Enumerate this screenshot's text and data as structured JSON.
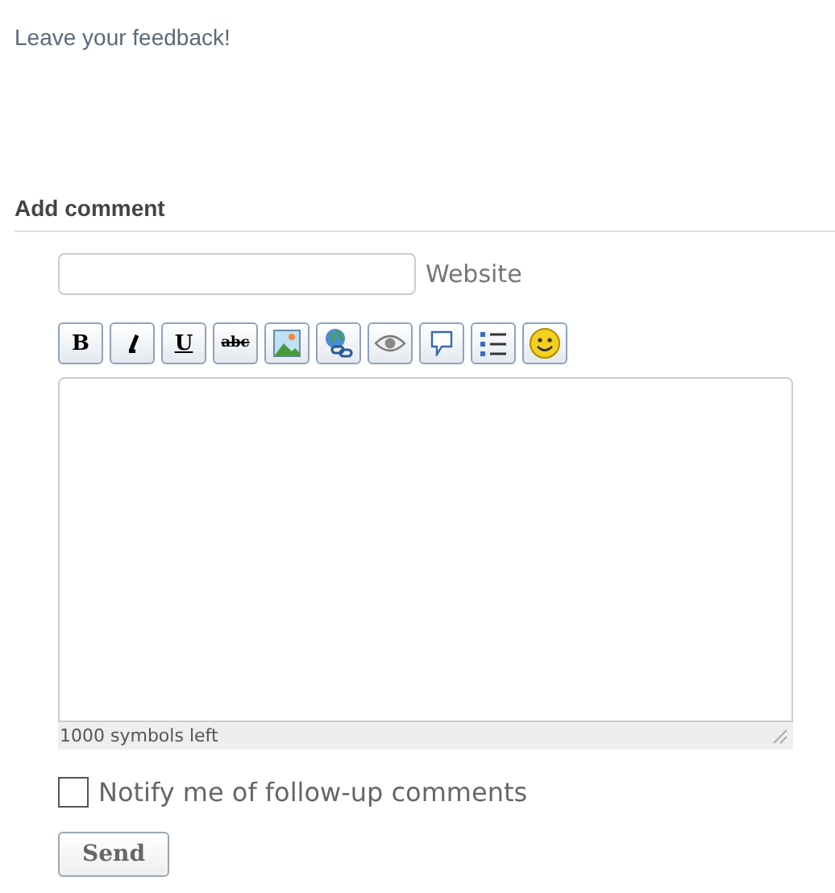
{
  "intro": "Leave your feedback!",
  "section_title": "Add comment",
  "website_field": {
    "label": "Website"
  },
  "toolbar": [
    {
      "kind": "bold",
      "label": "B"
    },
    {
      "kind": "italic"
    },
    {
      "kind": "underline",
      "label": "U"
    },
    {
      "kind": "strike",
      "label": "abc"
    },
    {
      "kind": "image"
    },
    {
      "kind": "link"
    },
    {
      "kind": "eye"
    },
    {
      "kind": "bubble"
    },
    {
      "kind": "list"
    },
    {
      "kind": "smiley"
    }
  ],
  "comment": {
    "counter": "1000 symbols left"
  },
  "notify": {
    "label": "Notify me of follow-up comments",
    "checked": false
  },
  "send_button": "Send"
}
